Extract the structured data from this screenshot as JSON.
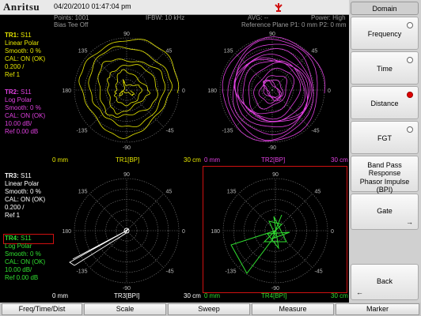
{
  "header": {
    "logo": "Anritsu",
    "datetime": "04/20/2010 01:47:04 pm"
  },
  "status": {
    "points": "Points: 1001",
    "bias_tee": "Bias Tee Off",
    "ifbw": "IFBW: 10 kHz",
    "avg": "AVG: --",
    "power": "Power: High",
    "ref_plane": "Reference Plane P1: 0 mm P2: 0 mm"
  },
  "colors": {
    "tr1": "#e8e800",
    "tr2": "#e040e0",
    "tr3": "#ffffff",
    "tr4": "#30e030",
    "active_frame": "#d01010",
    "grid": "#777777"
  },
  "polar_angles": {
    "top": "90",
    "upper_left": "135",
    "upper_right": "45",
    "left": "180",
    "right": "0",
    "lower_left": "-135",
    "lower_right": "-45",
    "bottom": "-90"
  },
  "traces": {
    "tr1": {
      "name": "TR1:",
      "param": "S11",
      "format": "Linear Polar",
      "smooth": "Smooth: 0 %",
      "cal": "CAL: ON (OK)",
      "scale": "0.200 /",
      "ref": "Ref 1",
      "x_start": "0 mm",
      "label": "TR1[BP]",
      "x_stop": "30 cm"
    },
    "tr2": {
      "name": "TR2:",
      "param": "S11",
      "format": "Log Polar",
      "smooth": "Smooth: 0 %",
      "cal": "CAL: ON (OK)",
      "scale": "10.00 dB/",
      "ref": "Ref 0.00 dB",
      "x_start": "0 mm",
      "label": "TR2[BP]",
      "x_stop": "30 cm"
    },
    "tr3": {
      "name": "TR3:",
      "param": "S11",
      "format": "Linear Polar",
      "smooth": "Smooth: 0 %",
      "cal": "CAL: ON (OK)",
      "scale": "0.200 /",
      "ref": "Ref 1",
      "x_start": "0 mm",
      "label": "TR3[BPI]",
      "x_stop": "30 cm"
    },
    "tr4": {
      "name": "TR4:",
      "param": "S11",
      "format": "Log Polar",
      "smooth": "Smooth: 0 %",
      "cal": "CAL: ON (OK)",
      "scale": "10.00 dB/",
      "ref": "Ref 0.00 dB",
      "x_start": "0 mm",
      "label": "TR4[BPI]",
      "x_stop": "30 cm"
    }
  },
  "softkeys": {
    "domain_title": "Domain",
    "frequency": "Frequency",
    "time": "Time",
    "distance": "Distance",
    "fgt": "FGT",
    "band_pass": "Band Pass Response",
    "phasor": "Phasor Impulse (BPI)",
    "gate": "Gate",
    "back": "Back",
    "selected": "distance"
  },
  "bottom_menu": [
    "Freq/Time/Dist",
    "Scale",
    "Sweep",
    "Measure",
    "Marker"
  ]
}
